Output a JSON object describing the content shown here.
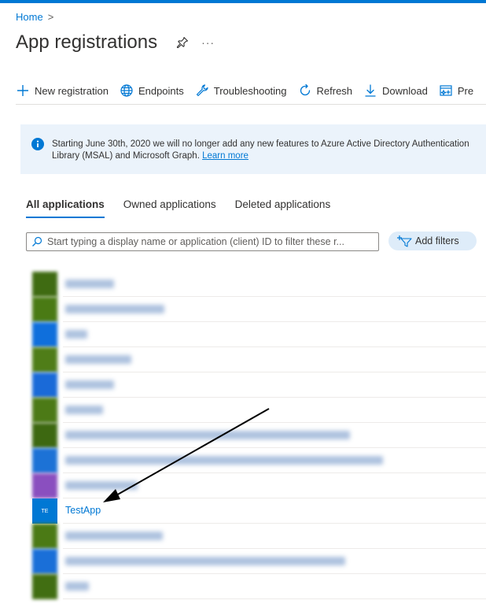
{
  "breadcrumb": {
    "home": "Home",
    "separator": ">"
  },
  "page": {
    "title": "App registrations",
    "more": "···"
  },
  "toolbar": {
    "new_registration": "New registration",
    "endpoints": "Endpoints",
    "troubleshooting": "Troubleshooting",
    "refresh": "Refresh",
    "download": "Download",
    "preview": "Pre"
  },
  "banner": {
    "line1": "Starting June 30th, 2020 we will no longer add any new features to Azure Active Directory Authentication",
    "line2": "Library (MSAL) and Microsoft Graph.",
    "link": "Learn more"
  },
  "tabs": [
    "All applications",
    "Owned applications",
    "Deleted applications"
  ],
  "search": {
    "placeholder": "Start typing a display name or application (client) ID to filter these r..."
  },
  "add_filters": "Add filters",
  "testapp": {
    "initials": "TE",
    "name": "TestApp"
  },
  "colors": {
    "accent": "#0078d4",
    "avatar_green": "#498205",
    "avatar_blue": "#0078d4",
    "avatar_purple": "#8764b8",
    "banner_bg": "#ebf3fb",
    "arrow": "#000000"
  }
}
